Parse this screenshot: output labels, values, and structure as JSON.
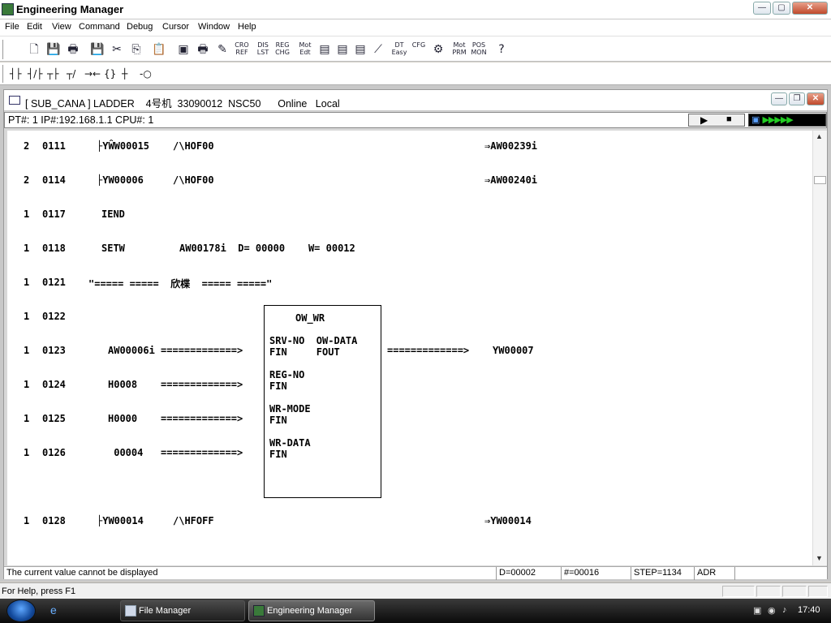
{
  "window": {
    "title": "Engineering Manager"
  },
  "menu": [
    "File",
    "Edit",
    "View",
    "Command",
    "Debug",
    "Cursor",
    "Window",
    "Help"
  ],
  "toolbar1": [
    {
      "name": "new-icon",
      "glyph": "🗋"
    },
    {
      "name": "save-icon",
      "glyph": "💾"
    },
    {
      "name": "print-icon",
      "glyph": "🖶"
    },
    {
      "name": "save-all-icon",
      "glyph": "💾"
    },
    {
      "name": "cut-icon",
      "glyph": "✂"
    },
    {
      "name": "copy-icon",
      "glyph": "⎘"
    },
    {
      "name": "paste-icon",
      "glyph": "📋"
    },
    {
      "name": "window-icon",
      "glyph": "▣"
    },
    {
      "name": "print-preview-icon",
      "glyph": "🖶"
    },
    {
      "name": "tag-icon",
      "glyph": "✎"
    },
    {
      "name": "cro-ref-button",
      "text": "CRO\nREF"
    },
    {
      "name": "dis-lst-button",
      "text": "DIS\nLST"
    },
    {
      "name": "reg-chg-button",
      "text": "REG\nCHG"
    },
    {
      "name": "mot-edt-button",
      "text": "Mot\nEdt"
    },
    {
      "name": "ee-icon",
      "glyph": "▤"
    },
    {
      "name": "eef-icon",
      "glyph": "▤"
    },
    {
      "name": "int-icon",
      "glyph": "▤"
    },
    {
      "name": "graph-icon",
      "glyph": "⟋"
    },
    {
      "name": "dt-easy-button",
      "text": "DT\nEasy"
    },
    {
      "name": "cfg-button",
      "text": "CFG"
    },
    {
      "name": "module-icon",
      "glyph": "⚙"
    },
    {
      "name": "mot-prm-button",
      "text": "Mot\nPRM"
    },
    {
      "name": "pos-mon-button",
      "text": "POS\nMON"
    },
    {
      "name": "help-icon",
      "glyph": "?"
    }
  ],
  "toolbar2": [
    "┤├",
    "┤/├",
    "┬├",
    "┬/",
    "→←",
    "{}",
    "┼",
    "-○"
  ],
  "child": {
    "title": "[ SUB_CANA ] LADDER    4号机  33090012  NSC50      Online   Local",
    "info": "PT#: 1 IP#:192.168.1.1 CPU#: 1",
    "run_glyphs": [
      "▶",
      "■"
    ],
    "leds": "▶▶▶▶▶"
  },
  "ladder_rows": [
    {
      "num": "2",
      "step": "0111",
      "c1": "├YŴ​W00015",
      "c2": "/\\HOF00",
      "out": "⇒AW00239i"
    },
    {
      "num": "2",
      "step": "0114",
      "c1": "├YW00006",
      "c2": "/\\HOF00",
      "out": "⇒AW00240i"
    },
    {
      "num": "1",
      "step": "0117",
      "c1": "IEND",
      "c2": "",
      "out": ""
    },
    {
      "num": "1",
      "step": "0118",
      "c1": "SETW",
      "c2": "AW00178i  D= 00000    W= 00012",
      "out": ""
    },
    {
      "num": "1",
      "step": "0121",
      "c1": "\"===== =====  欣楪  ===== =====\"",
      "c2": "",
      "out": ""
    },
    {
      "num": "1",
      "step": "0122",
      "c1": "",
      "c2": "",
      "out": ""
    },
    {
      "num": "1",
      "step": "0123",
      "c1": "AW00006i =============>",
      "c2": "",
      "out": "=============>    YW00007"
    },
    {
      "num": "1",
      "step": "0124",
      "c1": "H0008    =============>",
      "c2": "",
      "out": ""
    },
    {
      "num": "1",
      "step": "0125",
      "c1": "H0000    =============>",
      "c2": "",
      "out": ""
    },
    {
      "num": "1",
      "step": "0126",
      "c1": " 00004   =============>",
      "c2": "",
      "out": ""
    },
    {
      "num": "1",
      "step": "0128",
      "c1": "├YW00014",
      "c2": "/\\HFOFF",
      "out": "⇒YW00014"
    }
  ],
  "fblock": {
    "name": "OW_WR",
    "pins": [
      "SRV-NO  OW-DATA",
      "FIN     FOUT",
      "REG-NO",
      "FIN",
      "WR-MODE",
      "FIN",
      "WR-DATA",
      "FIN"
    ]
  },
  "child_status": {
    "message": "The current value cannot be displayed",
    "d": "D=00002",
    "n": "#=00016",
    "step": "STEP=1134",
    "mode": "ADR"
  },
  "statusbar": {
    "text": "For Help, press F1"
  },
  "taskbar": {
    "tasks": [
      "File Manager",
      "Engineering Manager"
    ],
    "clock": "17:40"
  }
}
